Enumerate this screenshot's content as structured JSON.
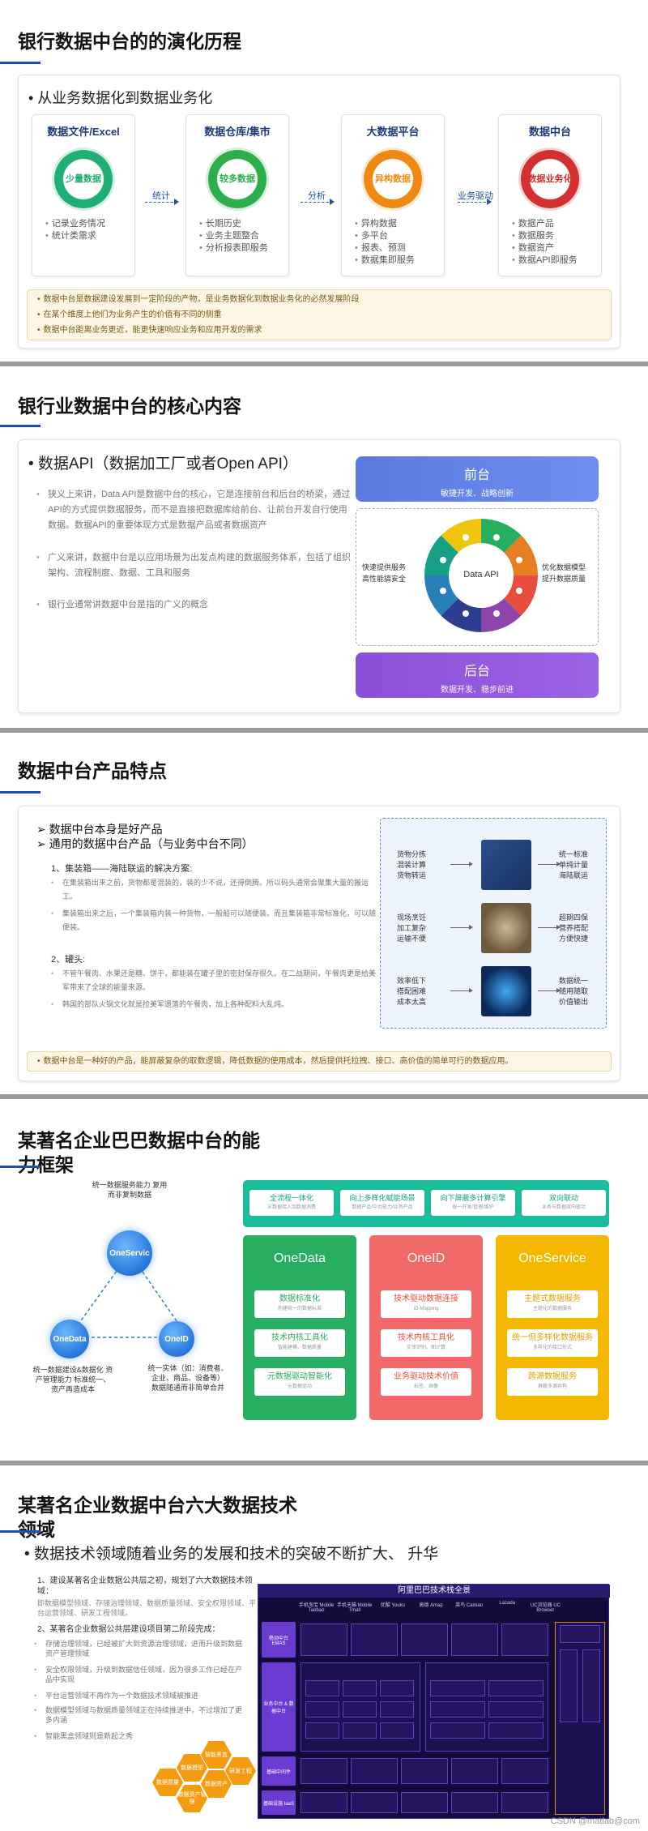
{
  "slide1": {
    "title": "银行数据中台的的演化历程",
    "bullet": "• 从业务数据化到数据业务化",
    "columns": [
      {
        "header": "数据文件/Excel",
        "circle": "少量数据",
        "items": [
          "记录业务情况",
          "统计类需求"
        ],
        "color": "#1fae73"
      },
      {
        "header": "数据仓库/集市",
        "circle": "较多数据",
        "items": [
          "长期历史",
          "业务主题整合",
          "分析报表即服务"
        ],
        "color": "#2cae4a"
      },
      {
        "header": "大数据平台",
        "circle": "异构数据",
        "items": [
          "异构数据",
          "多平台",
          "报表、预测",
          "数据集即服务"
        ],
        "color": "#ee8a12"
      },
      {
        "header": "数据中台",
        "circle": "数据业务化",
        "items": [
          "数据产品",
          "数据服务",
          "数据资产",
          "数据API即服务"
        ],
        "color": "#d32f2f"
      }
    ],
    "arrows": [
      "统计",
      "分析",
      "业务驱动"
    ],
    "notes": [
      "数据中台是数据建设发展到一定阶段的产物，是业务数据化到数据业务化的必然发展阶段",
      "在某个维度上他们为业务产生的价值有不同的侧重",
      "数据中台距离业务更近，能更快速响应业务和应用开发的需求"
    ]
  },
  "slide2": {
    "title": "银行业数据中台的核心内容",
    "bullet": "• 数据API（数据加工厂或者Open API）",
    "paras": [
      "狭义上来讲，Data API是数据中台的核心，它是连接前台和后台的桥梁，通过API的方式提供数据服务，而不是直接把数据库给前台、让前台开发自行使用数据。数据API的重要体现方式是数据产品或者数据资产",
      "广义来讲，数据中台是以应用场景为出发点构建的数据服务体系，包括了组织架构、流程制度、数据、工具和服务",
      "银行业通常讲数据中台是指的广义的概念"
    ],
    "front": {
      "title": "前台",
      "sub": "敏捷开发、战略创新"
    },
    "back": {
      "title": "后台",
      "sub": "数据开发、稳步前进"
    },
    "left_label": "快速提供服务 高性能搞安全",
    "right_label": "优化数据模型 提升数据质量",
    "center": "Data API"
  },
  "slide3": {
    "title": "数据中台产品特点",
    "bullets": [
      "➢ 数据中台本身是好产品",
      "➢ 通用的数据中台产品（与业务中台不同）"
    ],
    "sub1": "1、集装箱——海陆联运的解决方案:",
    "paras1": [
      "在集装箱出来之前，货物都是混装的，装的少不说，还得倒腾。所以码头通常会聚集大量的搬运工。",
      "集装箱出来之后，一个集装箱内装一种货物，一般船可以随便装。而且集装箱非常标准化，可以随便装。"
    ],
    "sub2": "2、罐头:",
    "paras2": [
      "不管午餐肉、水果还是糖、饼干，都能装在罐子里的密封保存很久。在二战期间，午餐肉更是给美军带来了全球的能量来源。",
      "韩国的部队火锅文化就是捡美军遗落的午餐肉，加上各种配料大乱炖。"
    ],
    "rows": [
      {
        "left": "货物分拣 混装计算 货物转运",
        "right": "统一标准 单纯计量 海陆联运"
      },
      {
        "left": "现场烹饪 加工复杂 运输不便",
        "right": "超期四保 营养搭配 方便快捷"
      },
      {
        "left": "效率低下 搭配困难 成本太高",
        "right": "数据统一 随用随取 价值输出"
      }
    ],
    "note": "数据中台是一种好的产品，能屏蔽复杂的取数逻辑，降低数据的使用成本，然后提供托拉拽、接口、高价值的简单可行的数据应用。"
  },
  "slide4": {
    "title": "某著名企业巴巴数据中台的能力框架",
    "title_l1": "某著名企业巴巴数据中台的能",
    "title_l2": "力框架",
    "top_items": [
      {
        "t": "全流程一体化",
        "s": "从数据接入到数据消费"
      },
      {
        "t": "向上多样化赋能场景",
        "s": "数据产品/中台能力/业务产品"
      },
      {
        "t": "向下屏蔽多计算引擎",
        "s": "统一开发/管理/维护"
      },
      {
        "t": "双向联动",
        "s": "业务与数据双向驱动"
      }
    ],
    "boxes": [
      {
        "name": "OneData",
        "color": "#27ae60",
        "items": [
          {
            "t": "数据标准化",
            "s": "构建统一的数据标准"
          },
          {
            "t": "技术内核工具化",
            "s": "智能建模、数据质量"
          },
          {
            "t": "元数据驱动智能化",
            "s": "元数据驱动"
          }
        ]
      },
      {
        "name": "OneID",
        "color": "#f06a6a",
        "items": [
          {
            "t": "技术驱动数据连接",
            "s": "ID-Mapping"
          },
          {
            "t": "技术内核工具化",
            "s": "实体识别、图计算"
          },
          {
            "t": "业务驱动技术价值",
            "s": "标签、画像"
          }
        ]
      },
      {
        "name": "OneService",
        "color": "#f5b800",
        "items": [
          {
            "t": "主题式数据服务",
            "s": "主题化的数据服务"
          },
          {
            "t": "统一但多样化数据服务",
            "s": "多样化的接口形式"
          },
          {
            "t": "跨源数据服务",
            "s": "屏蔽多源异构"
          }
        ]
      }
    ],
    "nodes": {
      "top": "OneServic",
      "left": "OneData",
      "right": "OneID"
    },
    "top_label": "统一数据服务能力 复用而非复制数据",
    "left_label": "统一数据建设&数据化 资产管理能力 标准统一、资产再造成本",
    "right_label": "统一实体（如：消费者、企业、商品、设备等） 数据随通而非简单合并"
  },
  "slide5": {
    "title_l1": "某著名企业数据中台六大数据技术",
    "title_l2": "领域",
    "bullet": "• 数据技术领域随着业务的发展和技术的突破不断扩大、 升华",
    "p1": "1、建设某著名企业数据公共层之初，规划了六大数据技术领域：",
    "p1b": "即数据模型领域、存储治理领域、数据质量领域、安全权限领域、平台运营领域、研发工程领域。",
    "p2": "2、某著名企业数据公共层建设项目第二阶段完成：",
    "items": [
      "存储治理领域，已经被扩大到资源治理领域，进而升级到数据资产管理领域",
      "安全权限领域，升级到数据信任领域，因为很多工作已经在产品中实现",
      "平台运营领域不再作为一个数据技术领域被推进",
      "数据模型领域与数据质量领域正在持续推进中，不过增加了更多内涵",
      "智能黑盒领域则是新起之秀"
    ],
    "hexes": [
      "数据质量",
      "数据模型",
      "智能黑盒",
      "数据资产管理",
      "数据资产",
      "研发工程"
    ],
    "ali_title": "阿里巴巴技术栈全景",
    "apps": [
      "手机淘宝 Mobile Taobao",
      "手机天猫 Mobile Tmall",
      "优酷 Youku",
      "高德 Amap",
      "菜鸟 Cainiao",
      "Lazada",
      "UC浏览器 UC Browser"
    ],
    "layers": [
      "移动中台 EMAS",
      "业务中台 & 数据中台",
      "基础中间件",
      "基础设施 IaaS"
    ],
    "footer": "CSDN @matlab@com"
  }
}
